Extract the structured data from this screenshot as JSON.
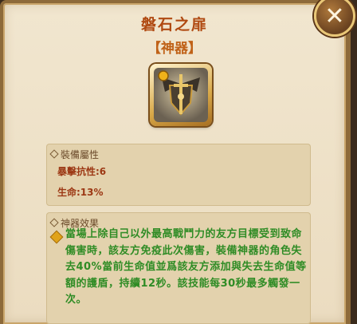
{
  "artifact": {
    "name": "磐石之扉",
    "category": "【神器】",
    "icon": "shield-sword-artifact-icon"
  },
  "attributes": {
    "header": "裝備屬性",
    "stats": [
      "暴擊抗性:6",
      "生命:13%"
    ]
  },
  "effect": {
    "header": "神器效果",
    "description": "當場上除自己以外最高戰鬥力的友方目標受到致命傷害時，該友方免疫此次傷害，裝備神器的角色失去40%當前生命值並爲該友方添加與失去生命值等額的護盾，持續12秒。該技能每30秒最多觸發一次。"
  },
  "colors": {
    "title": "#b04a12",
    "stat": "#9c3814",
    "effect": "#2f8c25",
    "panel": "#f1e6cf"
  }
}
